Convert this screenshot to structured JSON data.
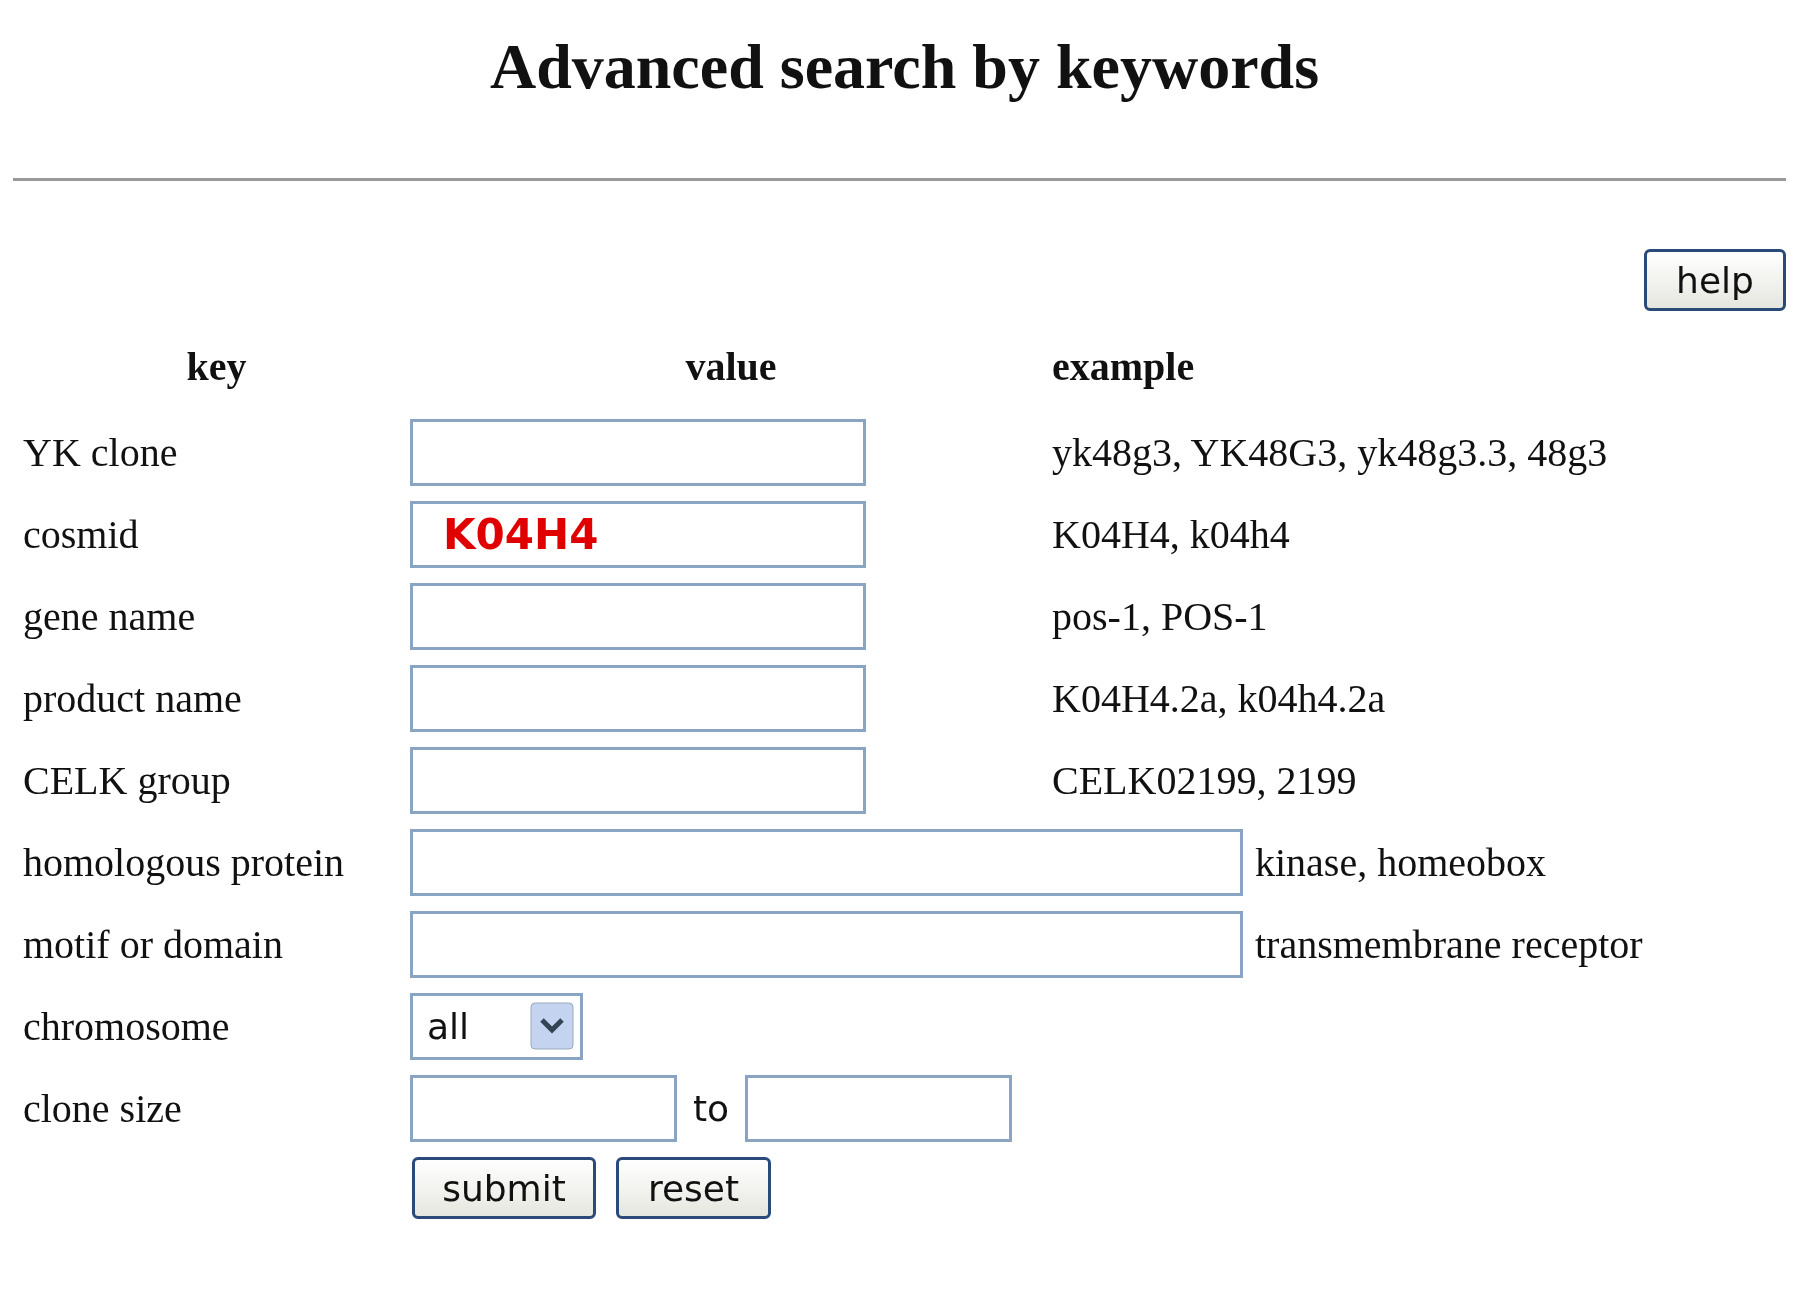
{
  "title": "Advanced search by keywords",
  "help_button": "help",
  "columns": [
    "key",
    "value",
    "example"
  ],
  "rows": [
    {
      "kind": "text",
      "key": "YK clone",
      "value": "",
      "example": "yk48g3, YK48G3, yk48g3.3, 48g3"
    },
    {
      "kind": "text",
      "key": "cosmid",
      "value": "K04H4",
      "example": "K04H4, k04h4"
    },
    {
      "kind": "text",
      "key": "gene name",
      "value": "",
      "example": "pos-1, POS-1"
    },
    {
      "kind": "text",
      "key": "product name",
      "value": "",
      "example": "K04H4.2a, k04h4.2a"
    },
    {
      "kind": "text",
      "key": "CELK group",
      "value": "",
      "example": "CELK02199, 2199"
    },
    {
      "kind": "wide",
      "key": "homologous protein",
      "value": "",
      "example": "kinase, homeobox"
    },
    {
      "kind": "wide",
      "key": "motif or domain",
      "value": "",
      "example": "transmembrane receptor"
    },
    {
      "kind": "select",
      "key": "chromosome",
      "value": "all"
    },
    {
      "kind": "range",
      "key": "clone size",
      "value": "",
      "separator": "to",
      "value_to": ""
    }
  ],
  "buttons": [
    "submit",
    "reset"
  ]
}
